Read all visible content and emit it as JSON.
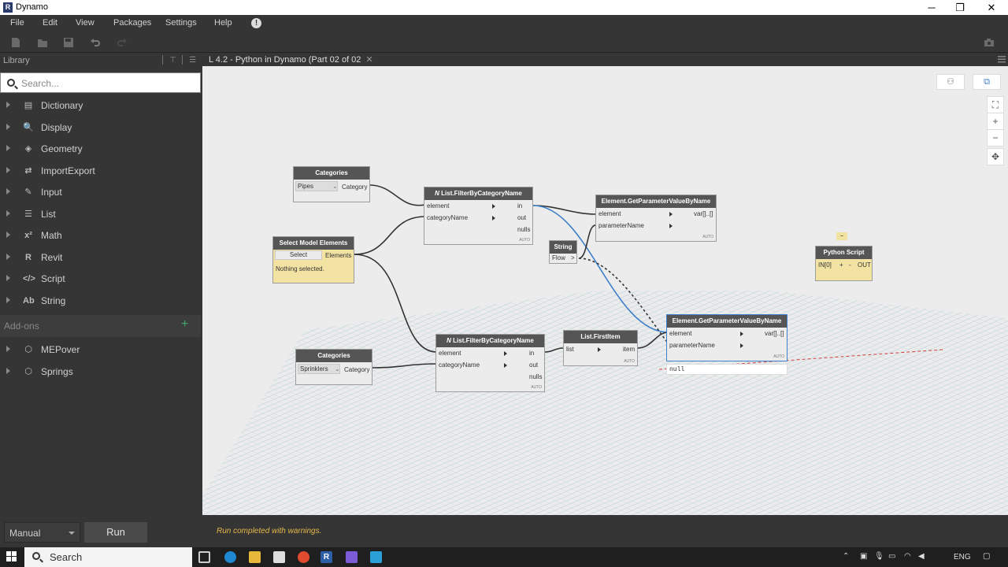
{
  "window": {
    "title": "Dynamo",
    "minimize": "─",
    "restore": "❐",
    "close": "✕"
  },
  "menu": [
    "File",
    "Edit",
    "View",
    "Packages",
    "Settings",
    "Help"
  ],
  "menu_notice": "!",
  "library": {
    "header": "Library",
    "header_icons": "│⊤│☰",
    "search_placeholder": "Search...",
    "items": [
      {
        "label": "Dictionary",
        "icon": "dictionary-icon",
        "glyph": "▤"
      },
      {
        "label": "Display",
        "icon": "display-icon",
        "glyph": "🔍"
      },
      {
        "label": "Geometry",
        "icon": "geometry-icon",
        "glyph": "◈"
      },
      {
        "label": "ImportExport",
        "icon": "import-export-icon",
        "glyph": "⇄"
      },
      {
        "label": "Input",
        "icon": "input-icon",
        "glyph": "✎"
      },
      {
        "label": "List",
        "icon": "list-icon",
        "glyph": "☰"
      },
      {
        "label": "Math",
        "icon": "math-icon",
        "glyph": "x²"
      },
      {
        "label": "Revit",
        "icon": "revit-icon",
        "glyph": "R"
      },
      {
        "label": "Script",
        "icon": "script-icon",
        "glyph": "</>"
      },
      {
        "label": "String",
        "icon": "string-icon",
        "glyph": "Ab"
      }
    ],
    "addons_header": "Add-ons",
    "addons_plus": "+",
    "addons": [
      {
        "label": "MEPover",
        "icon": "package-icon",
        "glyph": "⬡"
      },
      {
        "label": "Springs",
        "icon": "package-icon",
        "glyph": "⬡"
      }
    ]
  },
  "tab": {
    "title": "L 4.2 - Python in Dynamo (Part 02 of 02",
    "close": "✕"
  },
  "nodes": {
    "categories1": {
      "title": "Categories",
      "value": "Pipes",
      "out": "Category"
    },
    "select_model": {
      "title": "Select Model Elements",
      "button": "Select",
      "out": "Elements",
      "note": "Nothing selected."
    },
    "filter1": {
      "title": "List.FilterByCategoryName",
      "prefix": "N",
      "in1": "element",
      "in2": "categoryName",
      "out1": "in",
      "out2": "out",
      "out3": "nulls",
      "lacing": "AUTO"
    },
    "getparam1": {
      "title": "Element.GetParameterValueByName",
      "in1": "element",
      "in2": "parameterName",
      "out": "var[]..[]",
      "lacing": "AUTO"
    },
    "string": {
      "title": "String",
      "value": "Flow",
      "out": ">"
    },
    "python": {
      "title": "Python Script",
      "in": "IN[0]",
      "minus": "-",
      "out": "OUT",
      "tag": "−"
    },
    "categories2": {
      "title": "Categories",
      "value": "Sprinklers",
      "out": "Category"
    },
    "filter2": {
      "title": "List.FilterByCategoryName",
      "prefix": "N",
      "in1": "element",
      "in2": "categoryName",
      "out1": "in",
      "out2": "out",
      "out3": "nulls",
      "lacing": "AUTO"
    },
    "firstitem": {
      "title": "List.FirstItem",
      "in": "list",
      "out": "item",
      "lacing": "AUTO"
    },
    "getparam2": {
      "title": "Element.GetParameterValueByName",
      "in1": "element",
      "in2": "parameterName",
      "out": "var[]..[]",
      "lacing": "AUTO",
      "preview": "null"
    }
  },
  "canvas_controls": {
    "fit": "⛶",
    "zoom_in": "+",
    "zoom_out": "−",
    "pan": "✥"
  },
  "run": {
    "mode": "Manual",
    "button": "Run",
    "status": "Run completed with warnings."
  },
  "taskbar": {
    "search": "Search",
    "language": "ENG"
  },
  "colors": {
    "accent_wire": "#3d7fc9",
    "status": "#e5b84a",
    "addon_plus": "#3aa66b",
    "note_yellow": "#f3e3a3"
  }
}
